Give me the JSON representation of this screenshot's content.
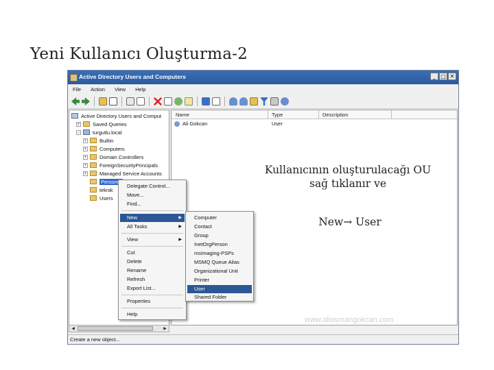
{
  "slide": {
    "title": "Yeni Kullanıcı Oluşturma-2",
    "annotation_line1": "Kullanıcının oluşturulacağı OU",
    "annotation_line2": "sağ tıklanır ve",
    "annotation_line3": "New→ User",
    "watermark": "www.aliosmangokcan.com"
  },
  "window": {
    "title": "Active Directory Users and Computers",
    "buttons": [
      "_",
      "□",
      "✕"
    ],
    "menu": [
      "File",
      "Action",
      "View",
      "Help"
    ],
    "toolbar_icons": [
      "back-icon",
      "forward-icon",
      "up-icon",
      "console-tree-icon",
      "cut-icon",
      "copy-icon",
      "delete-icon",
      "properties-icon",
      "refresh-icon",
      "export-icon",
      "help-icon",
      "filter-view-icon",
      "new-user-icon",
      "new-group-icon",
      "new-ou-icon",
      "filter-icon",
      "find-icon",
      "add-to-group-icon"
    ],
    "status": "Create a new object..."
  },
  "tree": {
    "items": [
      {
        "label": "Active Directory Users and Comput",
        "indent": 0
      },
      {
        "label": "Saved Queries",
        "indent": 1
      },
      {
        "label": "turgutlu.local",
        "indent": 1
      },
      {
        "label": "Builtin",
        "indent": 2
      },
      {
        "label": "Computers",
        "indent": 2
      },
      {
        "label": "Domain Controllers",
        "indent": 2
      },
      {
        "label": "ForeignSecurityPrincipals",
        "indent": 2
      },
      {
        "label": "Managed Service Accounts",
        "indent": 2
      },
      {
        "label": "Personel",
        "indent": 2
      },
      {
        "label": "teknik",
        "indent": 2
      },
      {
        "label": "Users",
        "indent": 2
      }
    ]
  },
  "list": {
    "columns": [
      "Name",
      "Type",
      "Description"
    ],
    "rows": [
      {
        "name": "Ali Gokcan",
        "type": "User",
        "description": ""
      }
    ]
  },
  "context_menu": {
    "items": [
      "Delegate Control...",
      "Move...",
      "Find...",
      "New",
      "All Tasks",
      "View",
      "Cut",
      "Delete",
      "Rename",
      "Refresh",
      "Export List...",
      "Properties",
      "Help"
    ]
  },
  "new_submenu": {
    "items": [
      "Computer",
      "Contact",
      "Group",
      "InetOrgPerson",
      "msImaging-PSPs",
      "MSMQ Queue Alias",
      "Organizational Unit",
      "Printer",
      "User",
      "Shared Folder"
    ]
  },
  "colors": {
    "titlebar": "#2f63aa",
    "highlight": "#2b5797",
    "folder": "#e9c66a"
  }
}
